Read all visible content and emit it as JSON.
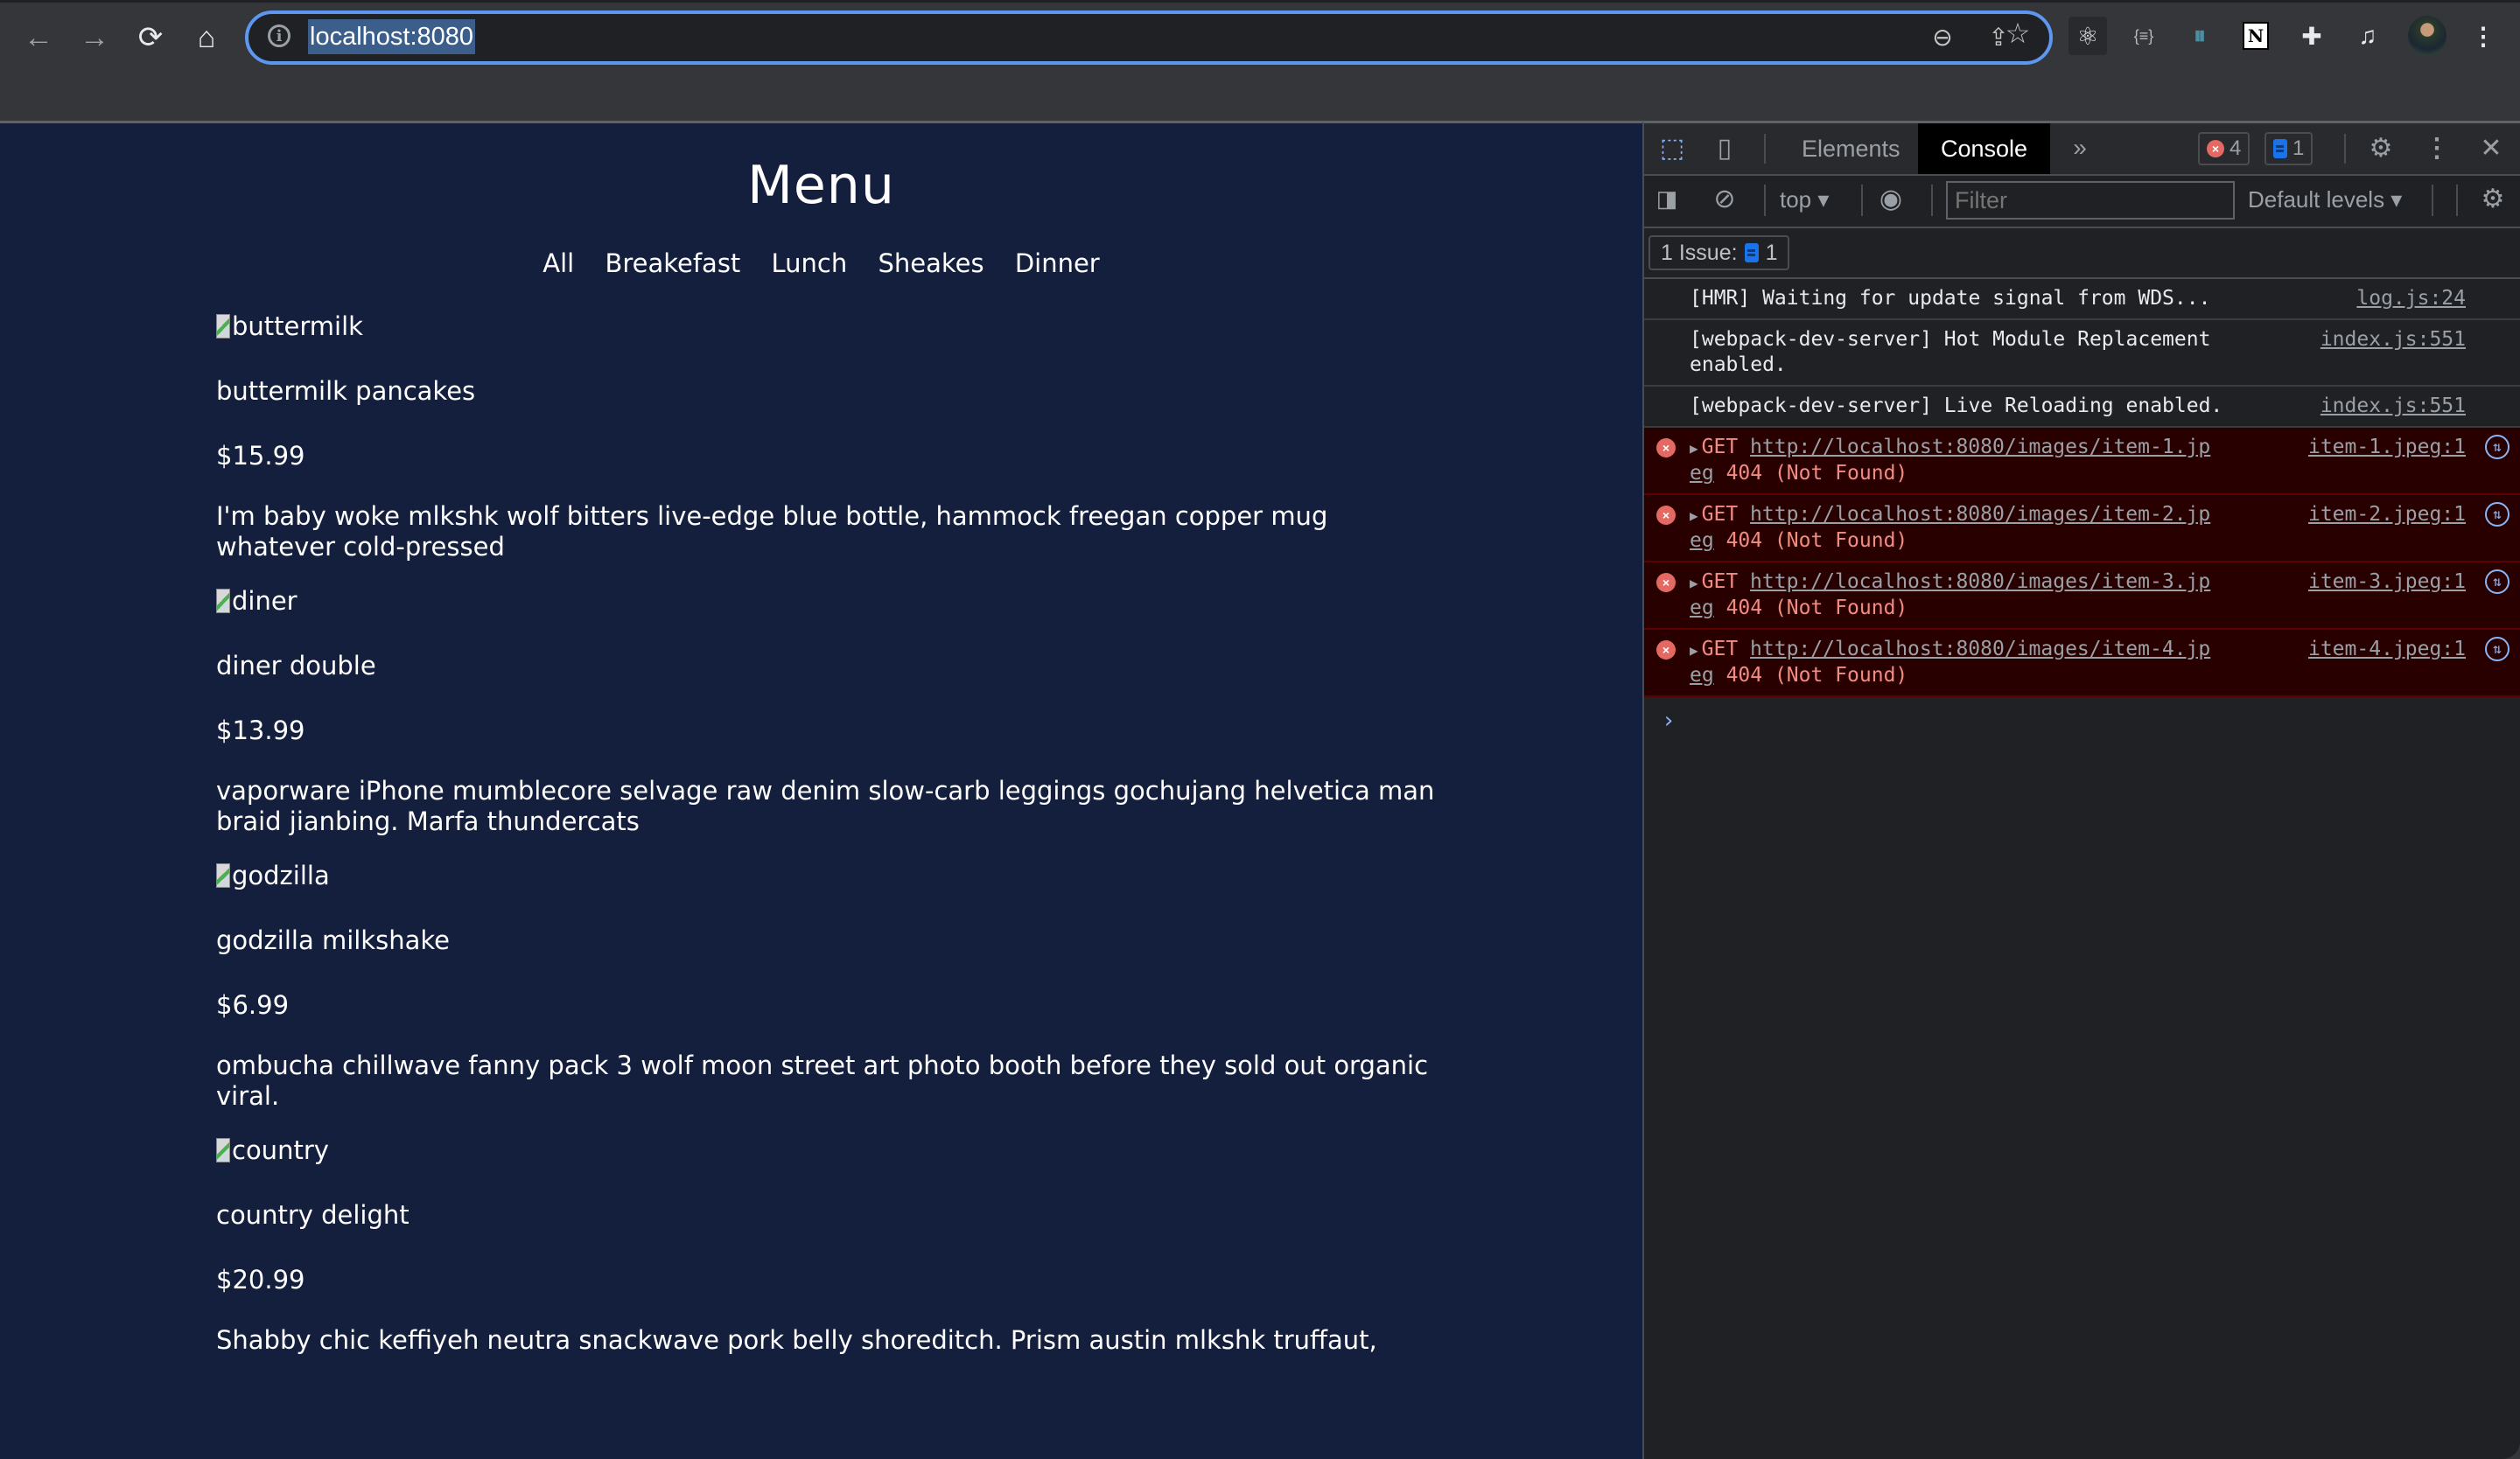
{
  "browser": {
    "url": "localhost:8080",
    "nav": {
      "back_icon": "←",
      "forward_icon": "→",
      "reload_icon": "⟳",
      "home_icon": "⌂"
    },
    "omnibox_icons": {
      "zoom": "⊖",
      "share": "⇪",
      "bookmark": "☆"
    },
    "extensions": [
      "react-devtools",
      "json-formatter",
      "dashlane",
      "notion",
      "extensions-puzzle",
      "reading-list",
      "profile-avatar",
      "menu-kebab"
    ]
  },
  "page": {
    "title": "Menu",
    "filters": [
      "All",
      "Breakefast",
      "Lunch",
      "Sheakes",
      "Dinner"
    ],
    "items": [
      {
        "img_alt": "buttermilk",
        "name": "buttermilk pancakes",
        "price": "$15.99",
        "desc": "I'm baby woke mlkshk wolf bitters live-edge blue bottle, hammock freegan copper mug whatever cold-pressed"
      },
      {
        "img_alt": "diner",
        "name": "diner double",
        "price": "$13.99",
        "desc": "vaporware iPhone mumblecore selvage raw denim slow-carb leggings gochujang helvetica man braid jianbing. Marfa thundercats"
      },
      {
        "img_alt": "godzilla",
        "name": "godzilla milkshake",
        "price": "$6.99",
        "desc": "ombucha chillwave fanny pack 3 wolf moon street art photo booth before they sold out organic viral."
      },
      {
        "img_alt": "country",
        "name": "country delight",
        "price": "$20.99",
        "desc": "Shabby chic keffiyeh neutra snackwave pork belly shoreditch. Prism austin mlkshk truffaut,"
      }
    ]
  },
  "devtools": {
    "tabs": [
      "Elements",
      "Console"
    ],
    "active_tab": "Console",
    "more_tabs": "»",
    "error_count": "4",
    "message_count": "1",
    "context": "top ▾",
    "filter_placeholder": "Filter",
    "levels": "Default levels ▾",
    "issues_label": "1 Issue:",
    "issues_count": "1",
    "logs": [
      {
        "text": "[HMR] Waiting for update signal from WDS...",
        "source": "log.js:24"
      },
      {
        "text": "[webpack-dev-server] Hot Module Replacement enabled.",
        "source": "index.js:551"
      },
      {
        "text": "[webpack-dev-server] Live Reloading enabled.",
        "source": "index.js:551"
      }
    ],
    "errors": [
      {
        "method": "GET",
        "url_a": "http://localhost:8080/images/item-1.jp",
        "url_b": "eg",
        "status": "404 (Not Found)",
        "source": "item-1.jpeg:1"
      },
      {
        "method": "GET",
        "url_a": "http://localhost:8080/images/item-2.jp",
        "url_b": "eg",
        "status": "404 (Not Found)",
        "source": "item-2.jpeg:1"
      },
      {
        "method": "GET",
        "url_a": "http://localhost:8080/images/item-3.jp",
        "url_b": "eg",
        "status": "404 (Not Found)",
        "source": "item-3.jpeg:1"
      },
      {
        "method": "GET",
        "url_a": "http://localhost:8080/images/item-4.jp",
        "url_b": "eg",
        "status": "404 (Not Found)",
        "source": "item-4.jpeg:1"
      }
    ],
    "prompt": "›",
    "colors": {
      "error_text": "#f28b82",
      "error_bg": "#290000",
      "accent": "#8ab4f8",
      "page_bg": "#141f3d"
    }
  }
}
